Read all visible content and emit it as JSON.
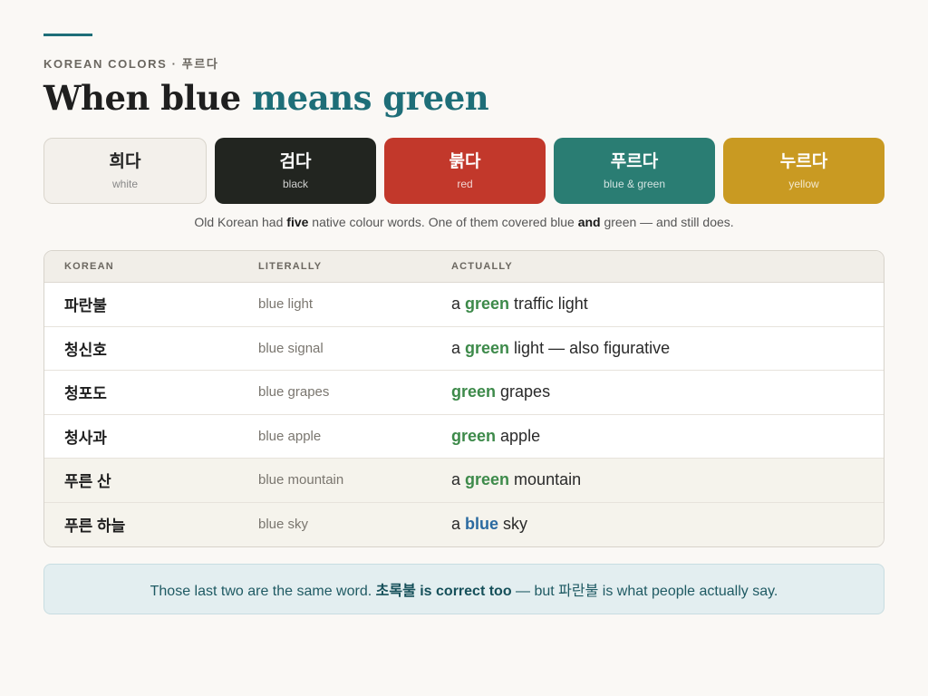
{
  "header": {
    "kicker": "KOREAN COLORS · 푸르다",
    "title_plain": "When blue ",
    "title_accent": "means green"
  },
  "swatches": [
    {
      "korean": "희다",
      "english": "white",
      "color": "#f3f0eb"
    },
    {
      "korean": "검다",
      "english": "black",
      "color": "#222520"
    },
    {
      "korean": "붉다",
      "english": "red",
      "color": "#c2382b"
    },
    {
      "korean": "푸르다",
      "english": "blue & green",
      "color": "#2a7d73"
    },
    {
      "korean": "누르다",
      "english": "yellow",
      "color": "#c99a22"
    }
  ],
  "caption": {
    "part1": "Old Korean had ",
    "bold1": "five",
    "part2": " native colour words. One of them covered blue ",
    "bold2": "and",
    "part3": " green — and still does."
  },
  "table": {
    "headers": [
      "KOREAN",
      "LITERALLY",
      "ACTUALLY"
    ],
    "rows": [
      {
        "korean": "파란불",
        "literally": "blue light",
        "pre": "a ",
        "key": "green",
        "post": " traffic light",
        "key_color": "green"
      },
      {
        "korean": "청신호",
        "literally": "blue signal",
        "pre": "a ",
        "key": "green",
        "post": " light — also figurative",
        "key_color": "green"
      },
      {
        "korean": "청포도",
        "literally": "blue grapes",
        "pre": "",
        "key": "green",
        "post": " grapes",
        "key_color": "green"
      },
      {
        "korean": "청사과",
        "literally": "blue apple",
        "pre": "",
        "key": "green",
        "post": " apple",
        "key_color": "green"
      },
      {
        "korean": "푸른 산",
        "literally": "blue mountain",
        "pre": "a ",
        "key": "green",
        "post": " mountain",
        "key_color": "green"
      },
      {
        "korean": "푸른 하늘",
        "literally": "blue sky",
        "pre": "a ",
        "key": "blue",
        "post": " sky",
        "key_color": "blue"
      }
    ]
  },
  "note": {
    "part1": "Those last two are the same word. ",
    "bold": "초록불 is correct too",
    "part2": " — but 파란불 is what people actually say."
  },
  "colors": {
    "accent": "#1e6e78",
    "green_word": "#3d8a4a",
    "blue_word": "#2b6aa0"
  }
}
